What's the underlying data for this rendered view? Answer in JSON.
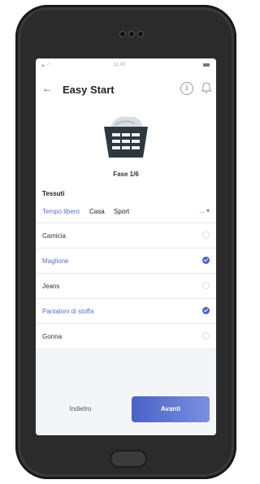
{
  "status": {
    "time": "11:00"
  },
  "appbar": {
    "title": "Easy Start",
    "back_icon": "arrow-left-icon",
    "info_icon": "info-icon",
    "bell_icon": "bell-icon"
  },
  "hero": {
    "image": "laundry-basket-icon",
    "step": "Fase 1/6"
  },
  "section": {
    "label": "Tessuti"
  },
  "tabs": [
    {
      "label": "Tempo libero",
      "active": true
    },
    {
      "label": "Casa",
      "active": false
    },
    {
      "label": "Sport",
      "active": false
    }
  ],
  "tabs_more": "...",
  "items": [
    {
      "label": "Camicia",
      "selected": false
    },
    {
      "label": "Maglione",
      "selected": true
    },
    {
      "label": "Jeans",
      "selected": false
    },
    {
      "label": "Pantaloni di stoffa",
      "selected": true
    },
    {
      "label": "Gonna",
      "selected": false
    }
  ],
  "footer": {
    "back_label": "Indietro",
    "next_label": "Avanti"
  },
  "colors": {
    "accent": "#4a63c9",
    "phone": "#2b2b2b"
  }
}
